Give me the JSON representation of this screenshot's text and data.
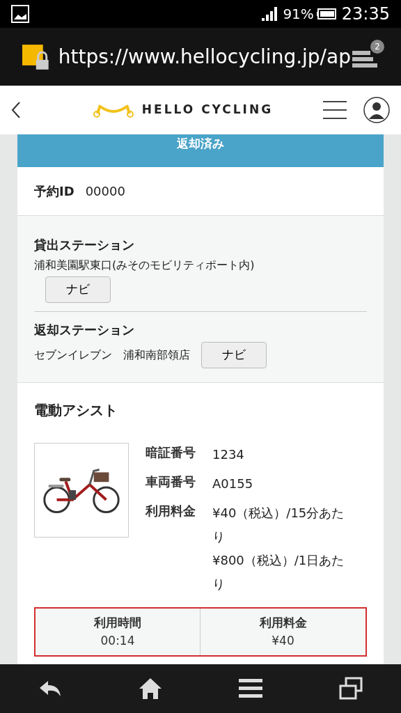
{
  "status_bar": {
    "battery": "91%",
    "time": "23:35",
    "notification_count": "2"
  },
  "browser": {
    "url": "https://www.hellocycling.jp/ap"
  },
  "header": {
    "logo": "HELLO CYCLING"
  },
  "status_banner": "返却済み",
  "reservation": {
    "label": "予約ID",
    "value": "00000"
  },
  "stations": [
    {
      "label": "貸出ステーション",
      "name": "浦和美園駅東口(みそのモビリティポート内)",
      "button": "ナビ"
    },
    {
      "label": "返却ステーション",
      "name": "セブンイレブン　浦和南部領店",
      "button": "ナビ"
    }
  ],
  "bike": {
    "type": "電動アシスト",
    "details": [
      {
        "label": "暗証番号",
        "values": [
          "1234"
        ]
      },
      {
        "label": "車両番号",
        "values": [
          "A0155"
        ]
      },
      {
        "label": "利用料金",
        "values": [
          "¥40（税込）/15分あたり",
          "¥800（税込）/1日あたり"
        ]
      }
    ]
  },
  "summary": [
    {
      "label": "利用時間",
      "value": "00:14"
    },
    {
      "label": "利用料金",
      "value": "¥40"
    }
  ]
}
